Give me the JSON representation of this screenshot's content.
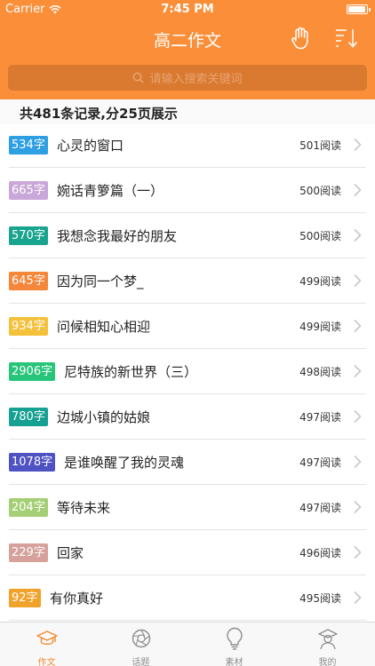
{
  "status_bar": {
    "carrier": "Carrier",
    "time": "7:45 PM",
    "battery_level": 0.95
  },
  "nav": {
    "title": "高二作文",
    "right_icons": [
      "hand-icon",
      "sort-icon"
    ]
  },
  "search": {
    "placeholder": "请输入搜索关键词"
  },
  "summary": {
    "text": "共481条记录,分25页展示"
  },
  "articles": [
    {
      "words": "534字",
      "title": "心灵的窗口",
      "reads": "501阅读",
      "badge_color": "#2d9fe3"
    },
    {
      "words": "665字",
      "title": "婉话青箩篇（一）",
      "reads": "500阅读",
      "badge_color": "#c9a7d8"
    },
    {
      "words": "570字",
      "title": "我想念我最好的朋友",
      "reads": "500阅读",
      "badge_color": "#18a48e"
    },
    {
      "words": "645字",
      "title": "因为同一个梦_",
      "reads": "499阅读",
      "badge_color": "#f5863a"
    },
    {
      "words": "934字",
      "title": "问候相知心相迎",
      "reads": "499阅读",
      "badge_color": "#f4c13b"
    },
    {
      "words": "2906字",
      "title": "尼特族的新世界（三）",
      "reads": "498阅读",
      "badge_color": "#27c57a"
    },
    {
      "words": "780字",
      "title": "边城小镇的姑娘",
      "reads": "497阅读",
      "badge_color": "#16a091"
    },
    {
      "words": "1078字",
      "title": "是谁唤醒了我的灵魂",
      "reads": "497阅读",
      "badge_color": "#4e52c3"
    },
    {
      "words": "204字",
      "title": "等待未来",
      "reads": "497阅读",
      "badge_color": "#a4cf74"
    },
    {
      "words": "229字",
      "title": "回家",
      "reads": "496阅读",
      "badge_color": "#d6a09b"
    },
    {
      "words": "92字",
      "title": "有你真好",
      "reads": "495阅读",
      "badge_color": "#f0a22a"
    }
  ],
  "tabs": [
    {
      "label": "作文",
      "icon": "graduation-cap-icon",
      "active": true
    },
    {
      "label": "话题",
      "icon": "aperture-icon",
      "active": false
    },
    {
      "label": "素材",
      "icon": "lightbulb-icon",
      "active": false
    },
    {
      "label": "我的",
      "icon": "user-icon",
      "active": false
    }
  ],
  "colors": {
    "header": "#fb8f39",
    "accent": "#f08a2e",
    "tab_inactive": "#8e8e8e"
  }
}
